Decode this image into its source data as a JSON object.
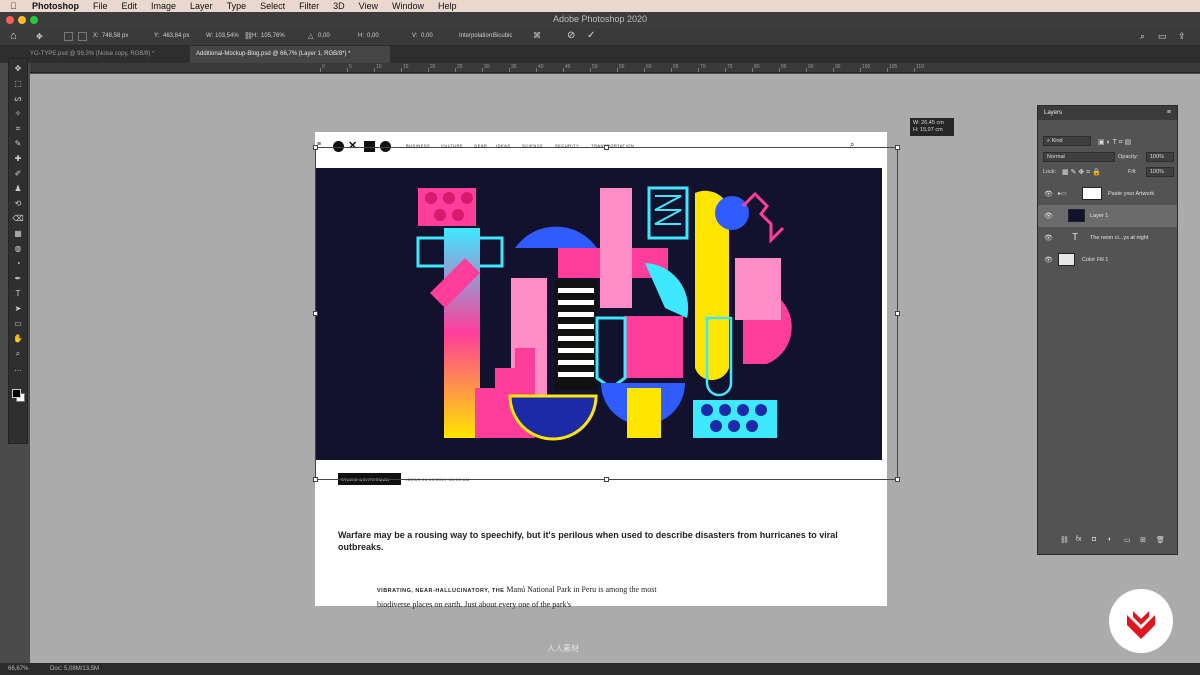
{
  "menubar": {
    "apple_icon": "apple-icon",
    "app_name": "Photoshop",
    "items": [
      "File",
      "Edit",
      "Image",
      "Layer",
      "Type",
      "Select",
      "Filter",
      "3D",
      "View",
      "Window",
      "Help"
    ]
  },
  "window": {
    "title": "Adobe Photoshop 2020",
    "traffic_colors": [
      "#ff5f57",
      "#febc2e",
      "#28c840"
    ]
  },
  "options": {
    "x_label": "X:",
    "x_value": "748,58 px",
    "y_label": "Y:",
    "y_value": "463,84 px",
    "w_label": "W:",
    "w_value": "103,54%",
    "h_label": "H:",
    "h_value": "105,76%",
    "rot_value": "0,00",
    "hskew_label": "H:",
    "hskew_value": "0,00",
    "vskew_label": "V:",
    "vskew_value": "0,00",
    "interp_label": "Interpolation:",
    "interp_value": "Bicubic",
    "cancel_icon": "cancel-icon",
    "commit_icon": "check-icon"
  },
  "tabs": [
    {
      "label": "YO-TYPE.psd @ 99,3% (Noise copy, RGB/8) *",
      "active": false
    },
    {
      "label": "Additional-Mockup-Blog.psd @ 66,7% (Layer 1, RGB/8*) *",
      "active": true
    }
  ],
  "ruler": {
    "ticks": [
      "0",
      "5",
      "10",
      "15",
      "20",
      "25",
      "30",
      "35",
      "40",
      "45",
      "50",
      "55",
      "60",
      "65",
      "70",
      "75",
      "80",
      "85",
      "90",
      "95",
      "100",
      "105",
      "110"
    ]
  },
  "toolbar": {
    "tools": [
      "move-tool-icon",
      "marquee-tool-icon",
      "lasso-tool-icon",
      "magic-wand-icon",
      "crop-tool-icon",
      "eyedropper-icon",
      "healing-brush-icon",
      "brush-tool-icon",
      "clone-stamp-icon",
      "history-brush-icon",
      "eraser-icon",
      "gradient-tool-icon",
      "blur-tool-icon",
      "dodge-tool-icon",
      "pen-tool-icon",
      "type-tool-icon",
      "path-selection-icon",
      "rectangle-tool-icon",
      "hand-tool-icon",
      "zoom-tool-icon",
      "more-tools-icon"
    ],
    "glyphs": [
      "✥",
      "⬚",
      "ᔕ",
      "✧",
      "⌗",
      "✎",
      "✚",
      "✐",
      "♟",
      "⟲",
      "⌫",
      "▦",
      "◍",
      "◔",
      "✒",
      "T",
      "➤",
      "▭",
      "✋",
      "⌕",
      "…"
    ]
  },
  "document": {
    "nav_links": [
      "BUSINESS",
      "CULTURE",
      "GEAR",
      "IDEAS",
      "SCIENCE",
      "SECURITY",
      "TRANSPORTATION"
    ],
    "badge": "STACIE ACHTERMAN",
    "meta": "IDEAS 05.15.2019 08:00 AM",
    "standfirst": "Warfare may be a rousing way to speechify, but it's perilous when used to describe disasters from hurricanes to viral outbreaks.",
    "lead_caps": "VIBRATING, NEAR-HALLUCINATORY, THE",
    "body": "Manú National Park in Peru is among the most biodiverse places on earth. Just about every one of the park's"
  },
  "dim_tooltip": {
    "w": "W: 26,45 cm",
    "h": "H: 15,07 cm"
  },
  "layers_panel": {
    "title": "Layers",
    "menu_icon": "panel-menu-icon",
    "filter_label": "Kind",
    "blend_mode": "Normal",
    "opacity_label": "Opacity:",
    "opacity_value": "100%",
    "lock_label": "Lock:",
    "fill_label": "Fill:",
    "fill_value": "100%",
    "layers": [
      {
        "name": "Paste your Artwork",
        "type": "group",
        "selected": false
      },
      {
        "name": "Layer 1",
        "type": "pixel",
        "selected": true
      },
      {
        "name": "The neon ci...ys at night",
        "type": "text",
        "selected": false
      },
      {
        "name": "Color Fill 1",
        "type": "fill",
        "selected": false
      }
    ],
    "footer_icons": [
      "link-layers-icon",
      "fx-icon",
      "add-mask-icon",
      "adjustment-layer-icon",
      "group-icon",
      "new-layer-icon",
      "trash-icon"
    ],
    "footer_glyphs": [
      "⛓",
      "fx",
      "◘",
      "◐",
      "▭",
      "⊞",
      "🗑"
    ]
  },
  "statusbar": {
    "zoom": "66,67%",
    "doc_info": "Doc: 5,08M/13,5M"
  },
  "watermark": "人人素材",
  "accent_colors": {
    "brand_red": "#e0161e",
    "neon_pink": "#ff3d9a",
    "neon_yellow": "#ffe600",
    "neon_cyan": "#3ee8ff",
    "navy": "#13122e"
  }
}
